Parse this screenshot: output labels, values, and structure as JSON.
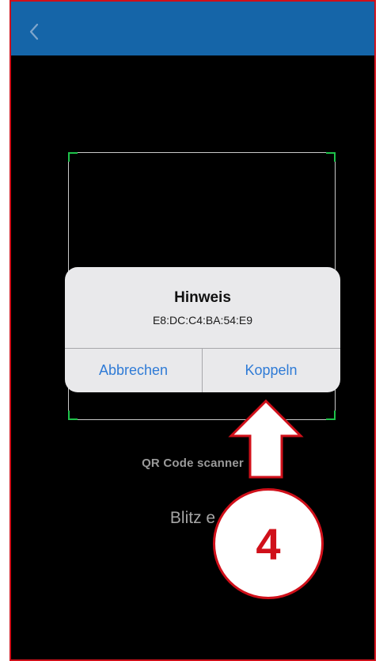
{
  "navbar": {
    "back_icon": "chevron-left-icon",
    "color": "#1565a8"
  },
  "scanner": {
    "label": "QR Code scanner",
    "flash_label": "Blitz e"
  },
  "alert": {
    "title": "Hinweis",
    "message": "E8:DC:C4:BA:54:E9",
    "cancel_label": "Abbrechen",
    "confirm_label": "Koppeln",
    "button_color": "#2f7bd6"
  },
  "annotation": {
    "step_number": "4",
    "accent_color": "#d0101a",
    "arrow_icon": "arrow-up-icon"
  }
}
